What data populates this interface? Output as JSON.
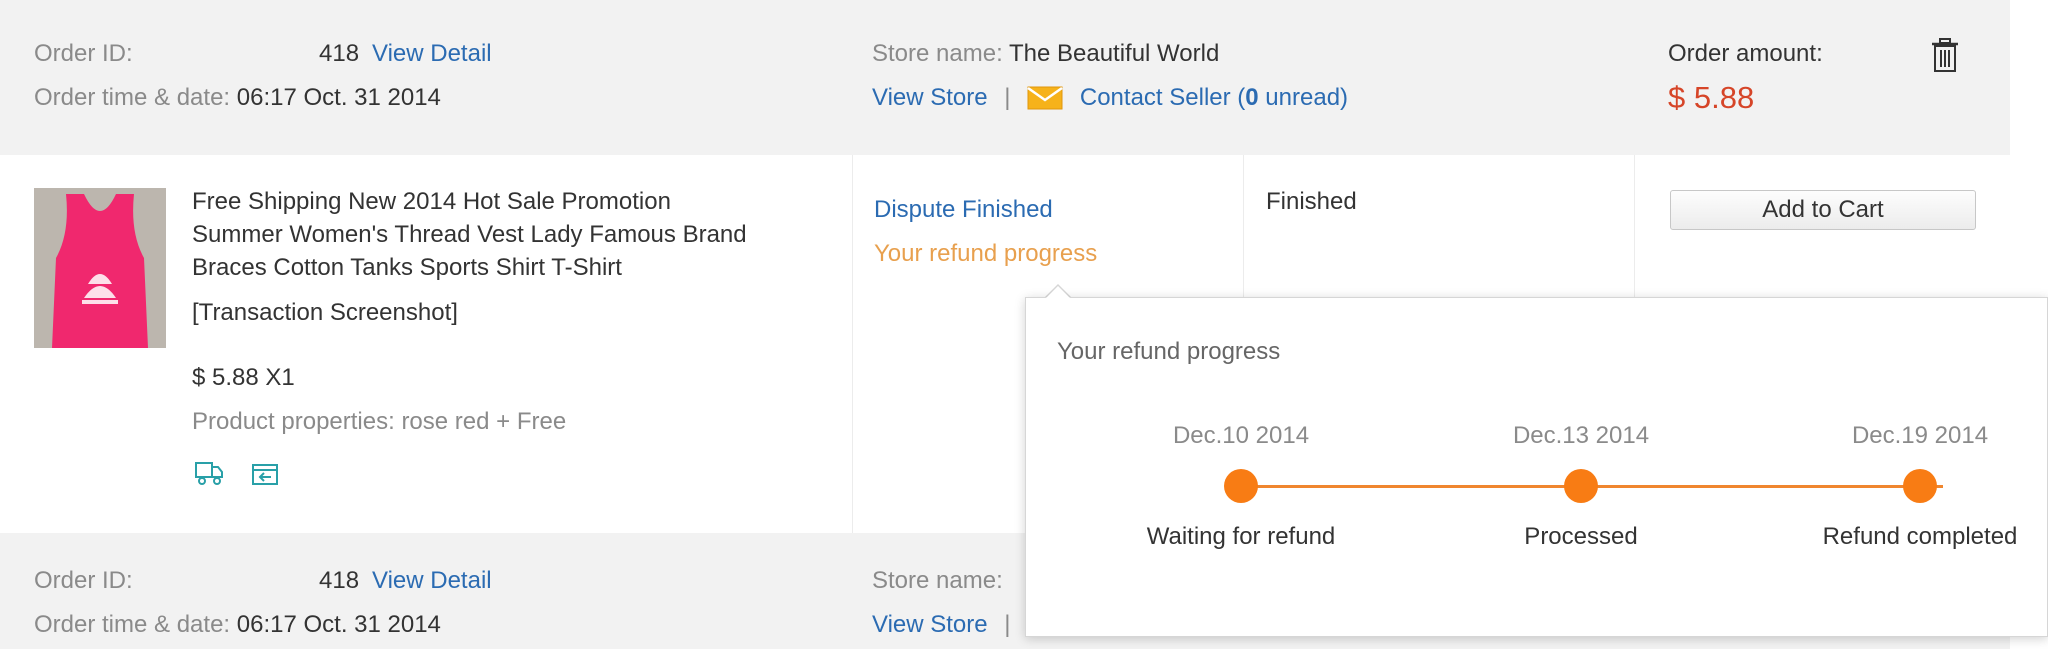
{
  "order1": {
    "order_id_label": "Order ID:",
    "order_id": "418",
    "view_detail": "View Detail",
    "time_label": "Order time & date:",
    "time_value": "06:17 Oct. 31 2014",
    "store_label": "Store name:",
    "store_name": "The Beautiful World",
    "view_store": "View Store",
    "separator": "|",
    "contact_seller": "Contact Seller (",
    "unread_count": "0",
    "unread_suffix": " unread)",
    "amount_label": "Order amount:",
    "amount_value": "$ 5.88"
  },
  "item": {
    "title_lines": [
      "Free Shipping New 2014 Hot Sale Promotion",
      "Summer Women's Thread Vest Lady Famous Brand",
      "Braces Cotton Tanks Sports Shirt T-Shirt"
    ],
    "screenshot_link": "[Transaction Screenshot]",
    "price_qty": "$ 5.88 X1",
    "properties": "Product properties: rose red + Free",
    "status_dispute": "Dispute Finished",
    "refund_progress_link": "Your refund progress",
    "order_status": "Finished",
    "add_to_cart": "Add to Cart"
  },
  "refund_popup": {
    "title": "Your refund progress",
    "steps": [
      {
        "date": "Dec.10 2014",
        "label": "Waiting for refund"
      },
      {
        "date": "Dec.13 2014",
        "label": "Processed"
      },
      {
        "date": "Dec.19 2014",
        "label": "Refund completed"
      }
    ]
  },
  "order2": {
    "order_id_label": "Order ID:",
    "order_id": "418",
    "view_detail": "View Detail",
    "time_label": "Order time & date:",
    "time_value": "06:17 Oct. 31 2014",
    "store_label": "Store name:",
    "view_store": "View Store",
    "separator": "|"
  },
  "colors": {
    "link": "#2b6bb2",
    "price": "#d64528",
    "refund_accent": "#f87c14",
    "header_bg": "#f2f2f2"
  },
  "icons": [
    "trash-icon",
    "envelope-icon",
    "logistics-truck-icon",
    "return-box-icon"
  ]
}
